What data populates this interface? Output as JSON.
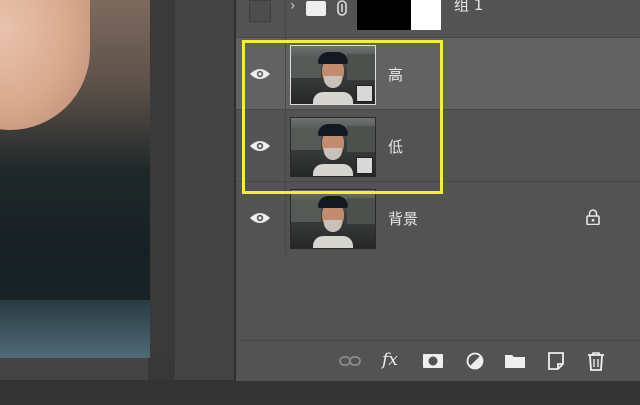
{
  "layers_panel": {
    "layers": [
      {
        "name": "组 1",
        "type": "group",
        "visible": false
      },
      {
        "name": "高",
        "type": "smart-object",
        "visible": true,
        "selected": true
      },
      {
        "name": "低",
        "type": "smart-object",
        "visible": true
      },
      {
        "name": "背景",
        "type": "background",
        "visible": true,
        "locked": true
      }
    ],
    "highlight_color": "#f4ec44",
    "toolbar_icons": [
      "link-icon",
      "fx-icon",
      "mask-icon",
      "adjustment-icon",
      "folder-icon",
      "new-layer-icon",
      "trash-icon"
    ],
    "fx_label": "fx"
  }
}
